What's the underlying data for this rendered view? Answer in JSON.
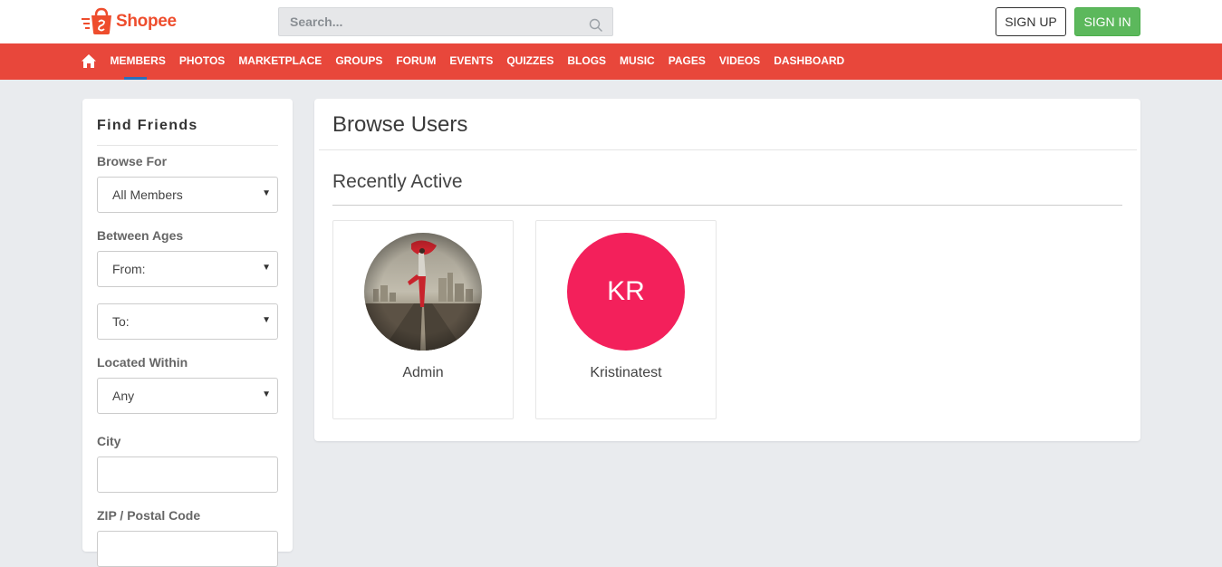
{
  "header": {
    "brand": "Shopee",
    "search_placeholder": "Search...",
    "signup_label": "SIGN UP",
    "signin_label": "SIGN IN",
    "brand_color": "#ee4d2d"
  },
  "nav": {
    "background": "#e8473b",
    "home_icon": "home-icon",
    "items": [
      {
        "label": "MEMBERS",
        "active": true
      },
      {
        "label": "PHOTOS"
      },
      {
        "label": "MARKETPLACE"
      },
      {
        "label": "GROUPS"
      },
      {
        "label": "FORUM"
      },
      {
        "label": "EVENTS"
      },
      {
        "label": "QUIZZES"
      },
      {
        "label": "BLOGS"
      },
      {
        "label": "MUSIC"
      },
      {
        "label": "PAGES"
      },
      {
        "label": "VIDEOS"
      },
      {
        "label": "DASHBOARD"
      }
    ]
  },
  "sidebar": {
    "title": "Find Friends",
    "browse_for_label": "Browse For",
    "browse_for_value": "All Members",
    "between_ages_label": "Between Ages",
    "age_from_value": "From:",
    "age_to_value": "To:",
    "located_within_label": "Located Within",
    "located_within_value": "Any",
    "city_label": "City",
    "city_value": "",
    "zip_label": "ZIP / Postal Code"
  },
  "main": {
    "title": "Browse Users",
    "section_title": "Recently Active",
    "users": [
      {
        "name": "Admin",
        "avatar": "photo"
      },
      {
        "name": "Kristinatest",
        "avatar": "initials",
        "initials": "KR",
        "avatar_color": "#f3205b"
      }
    ]
  }
}
